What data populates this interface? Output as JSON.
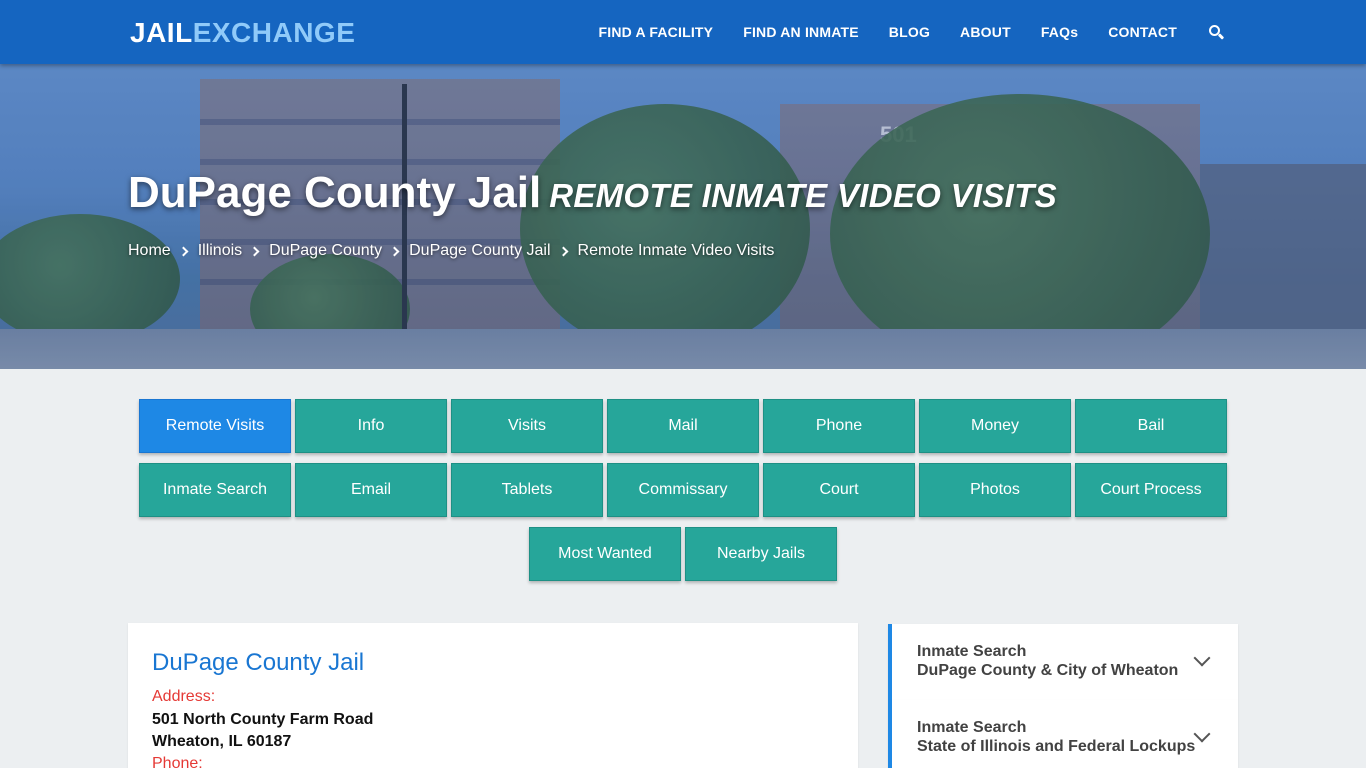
{
  "header": {
    "logo_part1": "JAIL",
    "logo_part2": "EXCHANGE",
    "nav": [
      "FIND A FACILITY",
      "FIND AN INMATE",
      "BLOG",
      "ABOUT",
      "FAQs",
      "CONTACT"
    ]
  },
  "hero": {
    "title": "DuPage County Jail",
    "subtitle": "REMOTE INMATE VIDEO VISITS",
    "building_number": "501",
    "breadcrumb": [
      "Home",
      "Illinois",
      "DuPage County",
      "DuPage County Jail",
      "Remote Inmate Video Visits"
    ]
  },
  "buttons": [
    "Remote Visits",
    "Info",
    "Visits",
    "Mail",
    "Phone",
    "Money",
    "Bail",
    "Inmate Search",
    "Email",
    "Tablets",
    "Commissary",
    "Court",
    "Photos",
    "Court Process",
    "Most Wanted",
    "Nearby Jails"
  ],
  "active_button": "Remote Visits",
  "card": {
    "title": "DuPage County Jail",
    "address_label": "Address:",
    "address_line1": "501 North County Farm Road",
    "address_line2": "Wheaton, IL 60187",
    "phone_label": "Phone:"
  },
  "sidebar": [
    {
      "line1": "Inmate Search",
      "line2": "DuPage County & City of Wheaton"
    },
    {
      "line1": "Inmate Search",
      "line2": "State of Illinois and Federal Lockups"
    }
  ],
  "colors": {
    "header": "#1565c0",
    "button": "#26a69a",
    "button_active": "#1e88e5",
    "card_title": "#1976d2",
    "label": "#e53935"
  }
}
